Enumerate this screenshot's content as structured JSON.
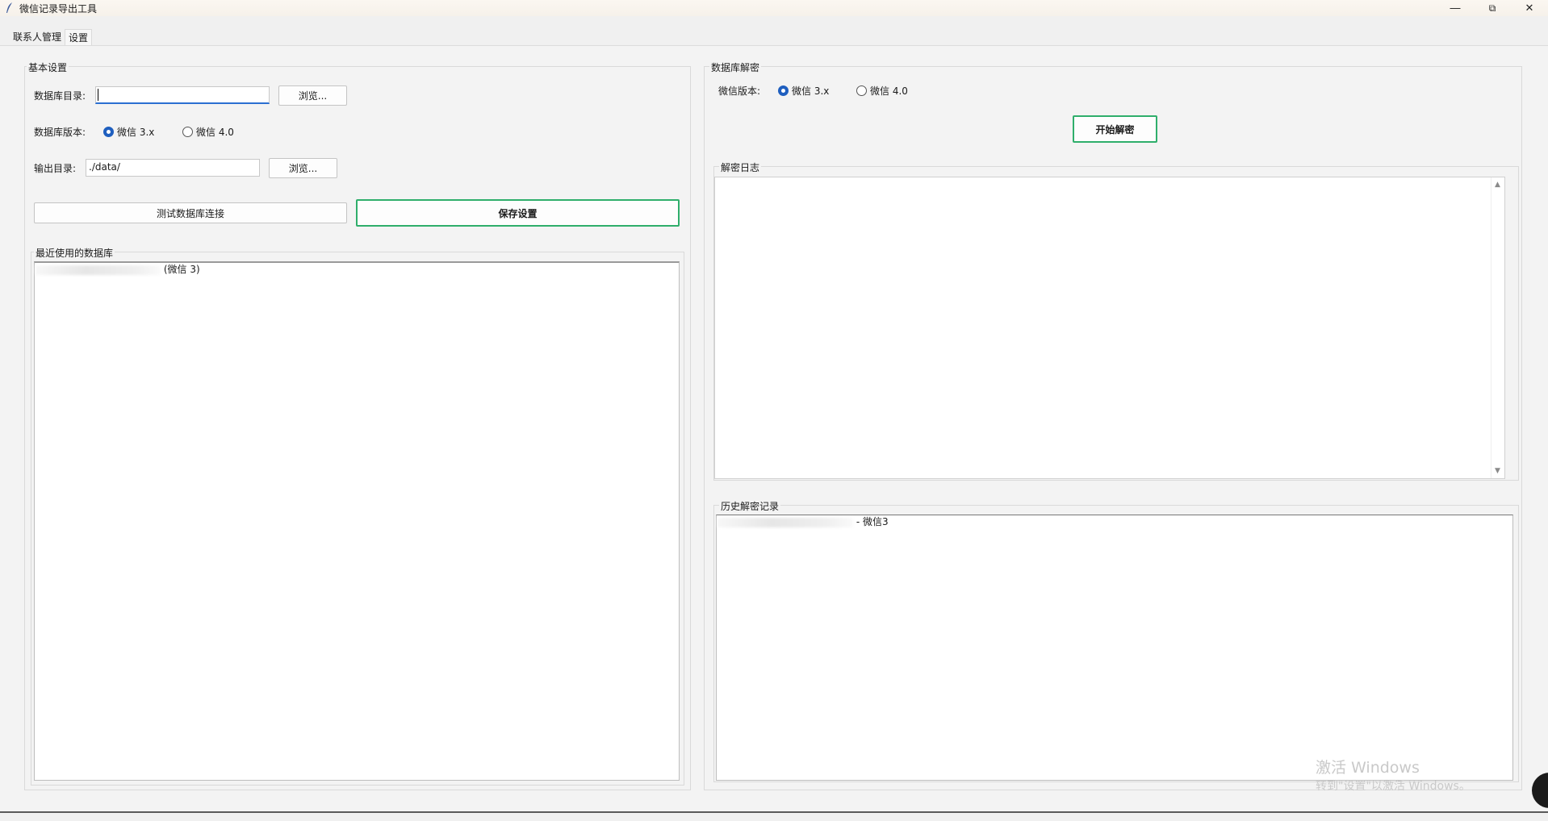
{
  "window": {
    "title": "微信记录导出工具",
    "icon": "feather-icon"
  },
  "tabs": [
    {
      "label": "联系人管理",
      "active": false
    },
    {
      "label": "设置",
      "active": true
    }
  ],
  "basic_settings": {
    "group_title": "基本设置",
    "db_dir_label": "数据库目录:",
    "db_dir_value": "",
    "browse1": "浏览...",
    "db_version_label": "数据库版本:",
    "version_options": [
      "微信 3.x",
      "微信 4.0"
    ],
    "version_selected": "微信 3.x",
    "output_dir_label": "输出目录:",
    "output_dir_value": "./data/",
    "browse2": "浏览...",
    "test_btn": "测试数据库连接",
    "save_btn": "保存设置"
  },
  "recent_db": {
    "group_title": "最近使用的数据库",
    "items": [
      {
        "suffix": "(微信 3)"
      }
    ]
  },
  "decrypt": {
    "group_title": "数据库解密",
    "version_label": "微信版本:",
    "version_options": [
      "微信 3.x",
      "微信 4.0"
    ],
    "version_selected": "微信 3.x",
    "start_btn": "开始解密"
  },
  "decrypt_log": {
    "group_title": "解密日志",
    "content": ""
  },
  "history": {
    "group_title": "历史解密记录",
    "items": [
      {
        "suffix": "- 微信3"
      }
    ]
  },
  "watermark": {
    "line1": "激活 Windows",
    "line2": "转到\"设置\"以激活 Windows。"
  },
  "colors": {
    "accent_green": "#2fae6b",
    "focus_blue": "#2b6fd1",
    "radio_blue": "#1f5fbf"
  }
}
